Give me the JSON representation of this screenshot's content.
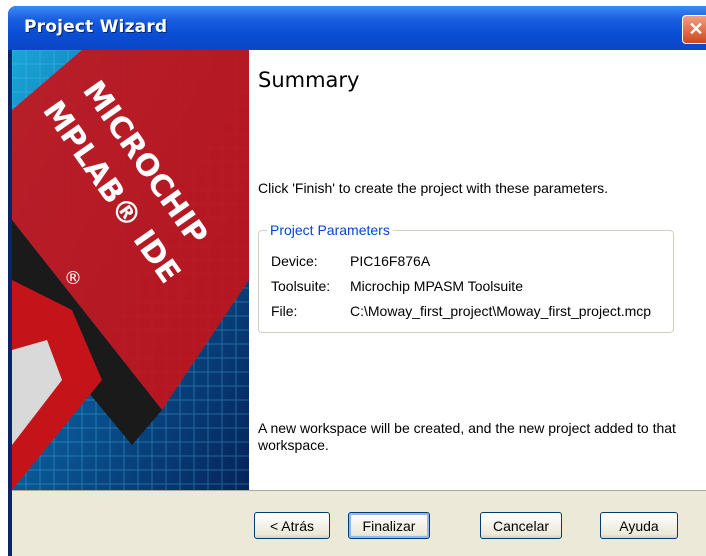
{
  "window": {
    "title": "Project Wizard",
    "close_glyph": "✕"
  },
  "page": {
    "heading": "Summary",
    "instruction": "Click 'Finish' to create the project with these parameters.",
    "group_label": "Project Parameters",
    "params": [
      {
        "key": "Device:",
        "value": "PIC16F876A"
      },
      {
        "key": "Toolsuite:",
        "value": "Microchip MPASM Toolsuite"
      },
      {
        "key": "File:",
        "value": "C:\\Moway_first_project\\Moway_first_project.mcp"
      }
    ],
    "note": "A new workspace will be created, and the new project added to that workspace."
  },
  "banner": {
    "brand_line1": "MICROCHIP",
    "brand_line2": "MPLAB® IDE",
    "registered": "®"
  },
  "buttons": {
    "back": "< Atrás",
    "finish": "Finalizar",
    "cancel": "Cancelar",
    "help": "Ayuda"
  }
}
